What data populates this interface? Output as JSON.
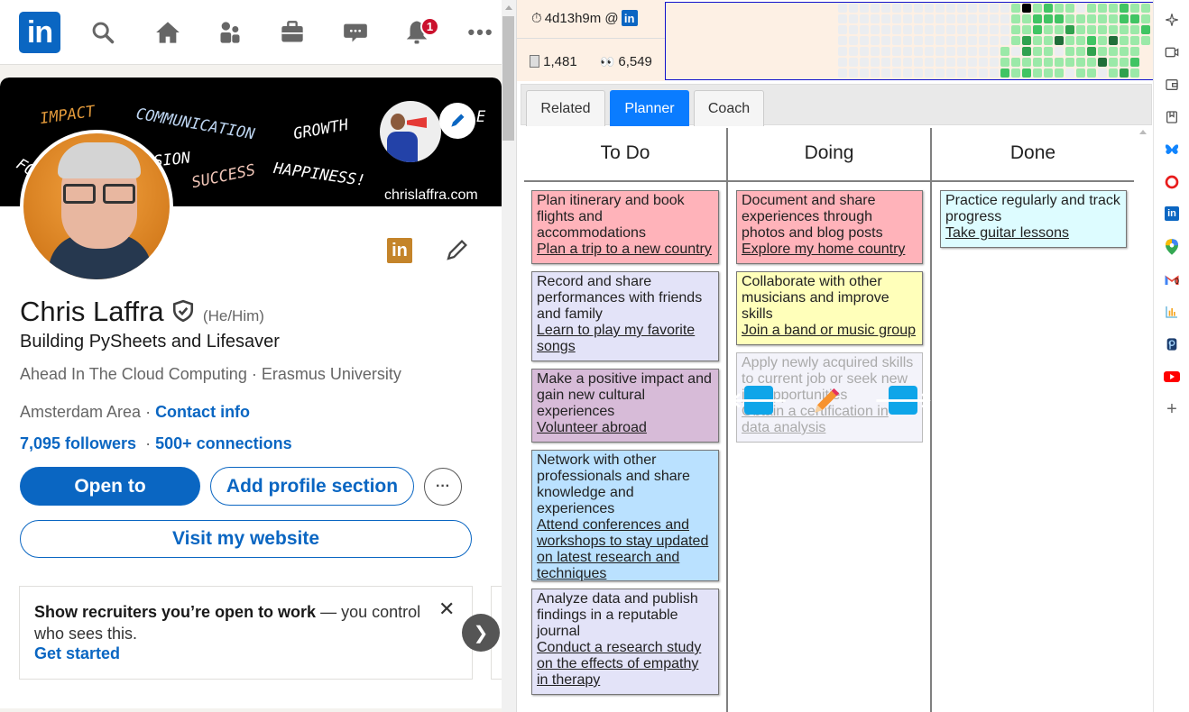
{
  "linkedin": {
    "nav": {
      "logo": "in",
      "notification_count": "1",
      "icons": [
        "search-icon",
        "home-icon",
        "my-network-icon",
        "jobs-icon",
        "messaging-icon",
        "notifications-icon",
        "more-icon"
      ]
    },
    "banner": {
      "words": [
        "IMPACT",
        "COMMUNICATION",
        "GROWTH",
        "FO",
        "SSION",
        "SUCCESS",
        "HAPPINESS!",
        "E"
      ],
      "site": "chrislaffra.com"
    },
    "profile": {
      "name": "Chris Laffra",
      "pronouns": "(He/Him)",
      "headline": "Building PySheets and Lifesaver",
      "company": "Ahead In The Cloud Computing",
      "separator": " · ",
      "school": "Erasmus University",
      "location": "Amsterdam Area",
      "location_sep": " · ",
      "contact_info": "Contact info",
      "followers": "7,095 followers",
      "stats_sep": "  · ",
      "connections": "500+ connections",
      "company_badge": "in"
    },
    "buttons": {
      "open_to": "Open to",
      "add_section": "Add profile section",
      "more": "···",
      "visit_website": "Visit my website"
    },
    "promo": {
      "bold": "Show recruiters you’re open to work",
      "rest": " — you control who sees this.",
      "cta": "Get started",
      "close": "✕",
      "next": "❯"
    }
  },
  "extension": {
    "stats": {
      "time": "4d13h9m @",
      "time_icon": "⏱",
      "site_badge": "in",
      "pages": "1,481",
      "views": "6,549"
    },
    "activity_heatmap": {
      "levels_legend": {
        "-1": "none",
        "0": "empty",
        "1": "light",
        "2": "medium",
        "3": "dark",
        "4": "darkest",
        "5": "today"
      },
      "colors": [
        "#ebedf0",
        "#9be9a8",
        "#40c463",
        "#30a14e",
        "#216e39",
        "#000000"
      ],
      "columns": [
        [
          0,
          0,
          0,
          0,
          0,
          0,
          0
        ],
        [
          0,
          0,
          0,
          0,
          0,
          0,
          0
        ],
        [
          0,
          0,
          0,
          0,
          0,
          0,
          0
        ],
        [
          0,
          0,
          0,
          0,
          0,
          0,
          0
        ],
        [
          0,
          0,
          0,
          0,
          0,
          0,
          0
        ],
        [
          0,
          0,
          0,
          0,
          0,
          0,
          0
        ],
        [
          0,
          0,
          0,
          0,
          0,
          0,
          0
        ],
        [
          0,
          0,
          0,
          0,
          0,
          0,
          0
        ],
        [
          0,
          0,
          0,
          0,
          0,
          0,
          0
        ],
        [
          0,
          0,
          0,
          0,
          0,
          0,
          0
        ],
        [
          0,
          0,
          0,
          0,
          0,
          0,
          0
        ],
        [
          0,
          0,
          0,
          0,
          0,
          0,
          0
        ],
        [
          0,
          0,
          0,
          0,
          0,
          0,
          0
        ],
        [
          0,
          0,
          0,
          0,
          0,
          0,
          0
        ],
        [
          0,
          0,
          0,
          0,
          0,
          0,
          0
        ],
        [
          0,
          0,
          0,
          0,
          1,
          1,
          2
        ],
        [
          1,
          1,
          1,
          1,
          0,
          1,
          1
        ],
        [
          5,
          1,
          1,
          3,
          3,
          1,
          2
        ],
        [
          1,
          2,
          2,
          1,
          1,
          1,
          1
        ],
        [
          2,
          2,
          1,
          1,
          1,
          1,
          1
        ],
        [
          1,
          2,
          1,
          4,
          0,
          1,
          1
        ],
        [
          1,
          1,
          3,
          1,
          1,
          1,
          0
        ],
        [
          0,
          1,
          1,
          1,
          1,
          1,
          1
        ],
        [
          1,
          1,
          1,
          2,
          3,
          1,
          1
        ],
        [
          1,
          1,
          1,
          1,
          1,
          4,
          0
        ],
        [
          1,
          1,
          1,
          4,
          1,
          1,
          1
        ],
        [
          2,
          2,
          1,
          1,
          1,
          1,
          3
        ],
        [
          1,
          2,
          1,
          1,
          1,
          2,
          1
        ],
        [
          1,
          1,
          2,
          1,
          -1,
          -1,
          -1
        ]
      ]
    },
    "tabs": [
      {
        "label": "Related",
        "active": false
      },
      {
        "label": "Planner",
        "active": true
      },
      {
        "label": "Coach",
        "active": false
      }
    ],
    "planner": {
      "columns": [
        {
          "title": "To Do",
          "cards": [
            {
              "task": "Plan itinerary and book flights and accommodations",
              "goal": "Plan a trip to a new country",
              "color": "#ffb3ba"
            },
            {
              "task": "Record and share performances with friends and family",
              "goal": "Learn to play my favorite songs",
              "color": "#e3e3f8"
            },
            {
              "task": "Make a positive impact and gain new cultural experiences",
              "goal": "Volunteer abroad",
              "color": "#d7bbd8"
            },
            {
              "task": "Network with other professionals and share knowledge and experiences",
              "goal": "Attend conferences and workshops to stay updated on latest research and techniques",
              "color": "#bae1ff"
            },
            {
              "task": "Analyze data and publish findings in a reputable journal",
              "goal": "Conduct a research study on the effects of empathy in therapy",
              "color": "#e3e3f8"
            }
          ]
        },
        {
          "title": "Doing",
          "cards": [
            {
              "task": "Document and share experiences through photos and blog posts",
              "goal": "Explore my home country",
              "color": "#ffb3ba"
            },
            {
              "task": "Collaborate with other musicians and improve skills",
              "goal": "Join a band or music group",
              "color": "#ffffba"
            },
            {
              "task": "Apply newly acquired skills to current job or seek new job opportunities",
              "goal": "Obtain a certification in data analysis",
              "color": "#f3f3fa",
              "faded": true
            }
          ]
        },
        {
          "title": "Done",
          "cards": [
            {
              "task": "Practice regularly and track progress",
              "goal": "Take guitar lessons",
              "color": "#ddfcff"
            }
          ]
        }
      ],
      "move_left": "🡐",
      "move_right": "🡒",
      "edit_icon": "✏"
    }
  },
  "browser_sidebar": {
    "icons": [
      "copilot-icon",
      "video-icon",
      "wallet-icon",
      "reading-list-icon",
      "bluesky-icon",
      "opera-icon",
      "linkedin-icon",
      "maps-icon",
      "gmail-icon",
      "analytics-icon",
      "pypi-icon",
      "youtube-icon",
      "add-icon"
    ],
    "gmail_count": "0"
  }
}
